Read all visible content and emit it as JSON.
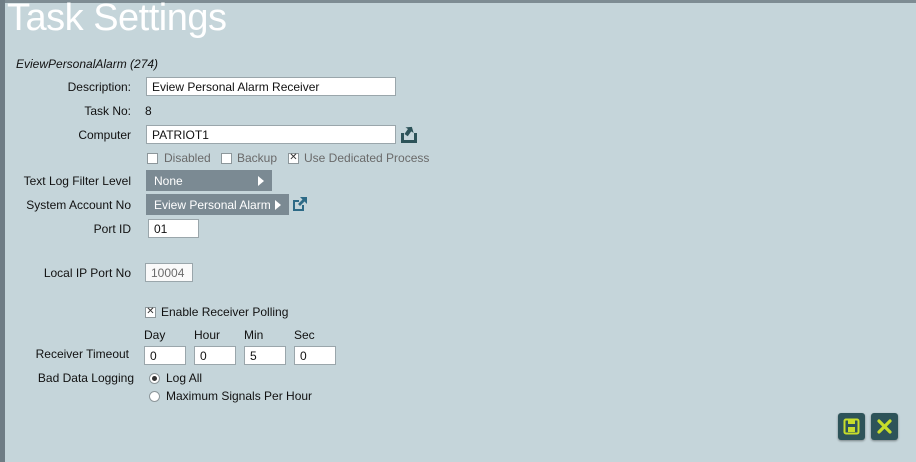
{
  "header": {
    "title": "Task Settings",
    "subtitle": "EviewPersonalAlarm (274)"
  },
  "form": {
    "description": {
      "label": "Description:",
      "value": "Eview Personal Alarm Receiver"
    },
    "task_no": {
      "label": "Task No:",
      "value": "8"
    },
    "computer": {
      "label": "Computer",
      "value": "PATRIOT1"
    },
    "options": {
      "disabled": {
        "label": "Disabled",
        "checked": false
      },
      "backup": {
        "label": "Backup",
        "checked": false
      },
      "dedicated": {
        "label": "Use Dedicated Process",
        "checked": true
      }
    },
    "text_log_filter": {
      "label": "Text Log Filter Level",
      "value": "None"
    },
    "system_account": {
      "label": "System Account No",
      "value": "Eview Personal Alarm"
    },
    "port_id": {
      "label": "Port ID",
      "value": "01"
    },
    "local_ip_port": {
      "label": "Local IP Port No",
      "value": "10004"
    },
    "enable_polling": {
      "label": "Enable Receiver Polling",
      "checked": true
    },
    "receiver_timeout": {
      "label": "Receiver Timeout",
      "headers": [
        "Day",
        "Hour",
        "Min",
        "Sec"
      ],
      "values": [
        "0",
        "0",
        "5",
        "0"
      ]
    },
    "bad_data_logging": {
      "label": "Bad Data Logging",
      "options": [
        "Log All",
        "Maximum Signals Per Hour"
      ],
      "selected": "Log All"
    }
  },
  "icons": {
    "upload": "upload-icon",
    "external_link": "external-link-icon",
    "save": "save-icon",
    "close": "close-icon"
  },
  "colors": {
    "background": "#c5d5da",
    "button": "#2d5359",
    "icon_accent": "#c7dd2b",
    "dropdown": "#7b8a93"
  }
}
